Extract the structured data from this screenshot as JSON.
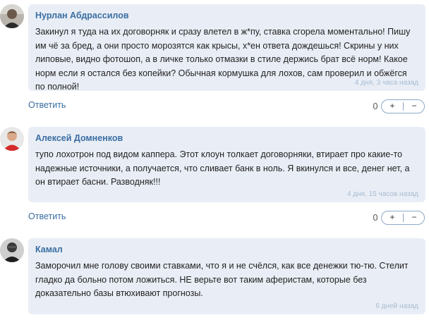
{
  "comments": [
    {
      "author": "Нурлан Абдрассилов",
      "text": "Закинул я туда на их договорняк и сразу влетел в ж*пу, ставка сгорела моментально! Пишу им чё за бред, а они просто морозятся как крысы, х*ен ответа дождешься! Скрины у них липовые, видно фотошоп, а в личке только отмазки в стиле держись брат всё норм! Какое норм если я остался без копейки? Обычная кормушка для лохов, сам проверил и обжёгся по полной!",
      "time": "4 дня, 3 часа назад",
      "reply_label": "Ответить",
      "votes": "0",
      "plus_label": "+",
      "minus_label": "−"
    },
    {
      "author": "Алексей Домненков",
      "text": "тупо лохотрон под видом каппера. Этот клоун толкает договорняки, втирает про какие-то надежные источники, а получается, что сливает банк в ноль. Я вкинулся и все, денег нет, а он втирает басни. Разводняк!!!",
      "time": "4 дня, 15 часов назад",
      "reply_label": "Ответить",
      "votes": "0",
      "plus_label": "+",
      "minus_label": "−"
    },
    {
      "author": "Камал",
      "text": "Заморочил мне голову своими ставками, что я и не счёлся, как все денежки тю-тю. Стелит гладко да больно потом ложиться. НЕ верьте вот таким аферистам, которые без доказательно базы втюхивают прогнозы.",
      "time": "6 дней назад"
    }
  ]
}
